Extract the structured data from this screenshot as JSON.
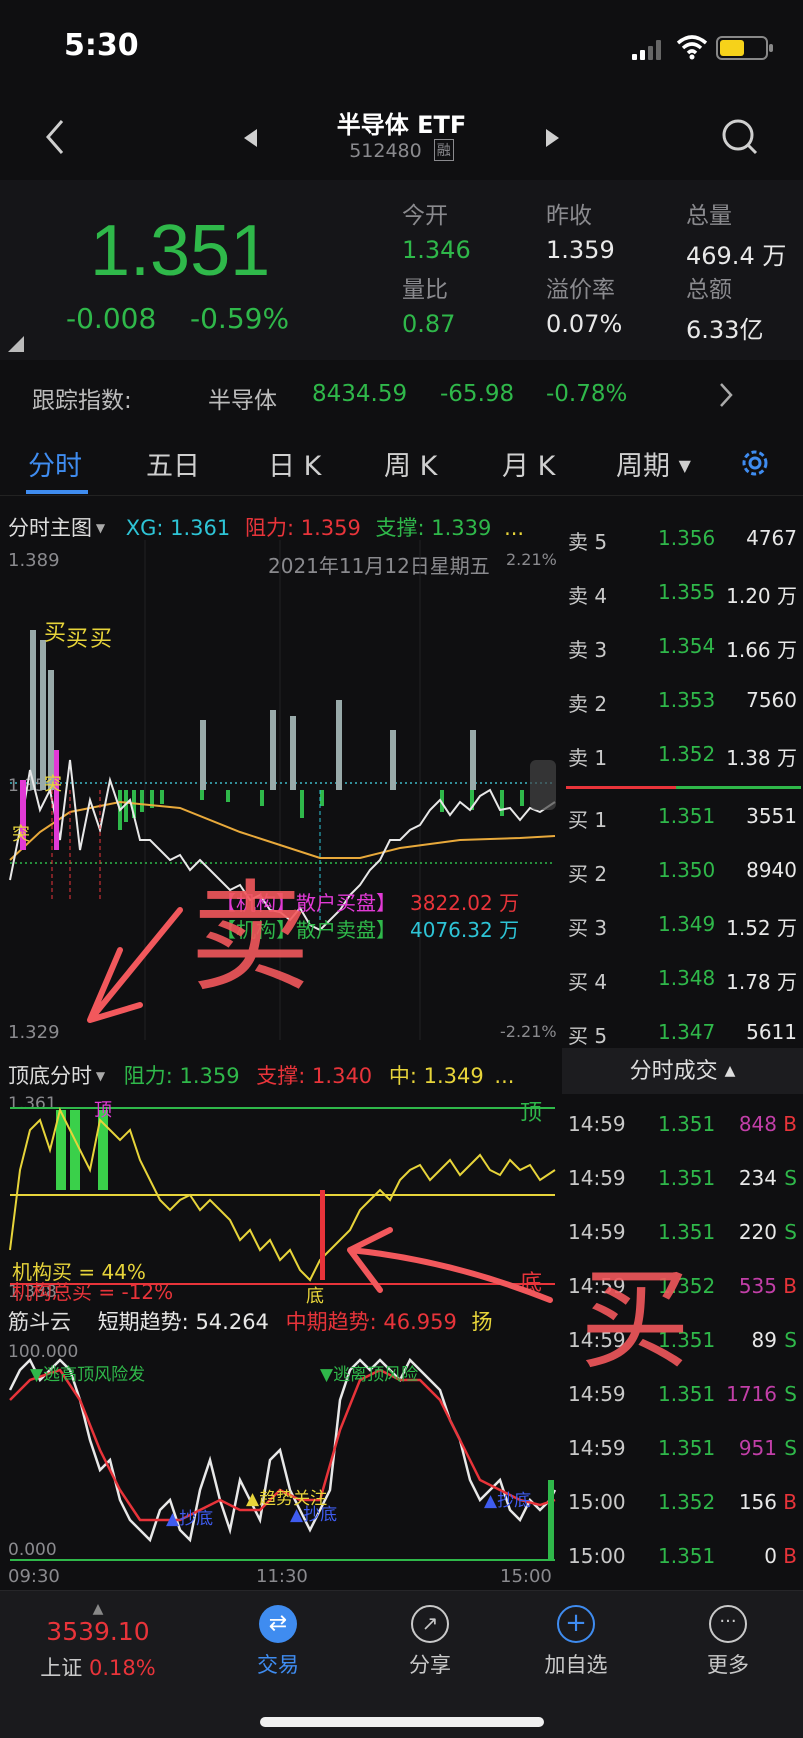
{
  "status": {
    "time": "5:30"
  },
  "nav": {
    "title": "半导体 ETF",
    "code": "512480",
    "badge": "融"
  },
  "quote": {
    "price": "1.351",
    "change": "-0.008",
    "change_pct": "-0.59%",
    "stats": [
      {
        "label": "今开",
        "value": "1.346",
        "color": "green"
      },
      {
        "label": "昨收",
        "value": "1.359",
        "color": "white"
      },
      {
        "label": "总量",
        "value": "469.4 万",
        "color": "white"
      },
      {
        "label": "量比",
        "value": "0.87",
        "color": "green"
      },
      {
        "label": "溢价率",
        "value": "0.07%",
        "color": "white"
      },
      {
        "label": "总额",
        "value": "6.33亿",
        "color": "white"
      }
    ]
  },
  "tracking": {
    "label": "跟踪指数:",
    "name": "半导体",
    "value": "8434.59",
    "change": "-65.98",
    "pct": "-0.78%"
  },
  "tabs": [
    "分时",
    "五日",
    "日 K",
    "周 K",
    "月 K",
    "周期"
  ],
  "main_chart": {
    "title": "分时主图",
    "xg": "XG: 1.361",
    "resistance": "阻力: 1.359",
    "support": "支撑: 1.339",
    "more": "...",
    "high": "1.389",
    "low": "1.329",
    "date": "2021年11月12日星期五",
    "pct_top": "2.21%",
    "pct_bottom": "-2.21%",
    "mid": "1.359",
    "buy_mark": "买",
    "tu_mark": "突",
    "annotation_sell": "卖",
    "legend_line1": "【机构】散户买盘】",
    "legend_val1": "3822.02 万",
    "legend_line2": "【机构】散户卖盘】",
    "legend_val2": "4076.32 万"
  },
  "top_bottom_chart": {
    "title": "顶底分时",
    "resistance": "阻力: 1.359",
    "support": "支撑: 1.340",
    "mid": "中: 1.349",
    "more": "...",
    "top_label": "顶",
    "bottom_label": "底",
    "high": "1.361",
    "low": "1.338",
    "inst_buy": "机构买 = 44%",
    "inst_total": "机构总买 = -12%",
    "annotation_buy": "买"
  },
  "cloud_chart": {
    "title": "筋斗云",
    "short": "短期趋势: 54.264",
    "mid": "中期趋势: 46.959",
    "tail": "扬",
    "y_top": "100.000",
    "y_bottom": "0.000",
    "label_launch": "▼逃离顶风险",
    "label_launch2": "▼逃高顶风险发",
    "label_bottom": "▲抄底",
    "label_bottom2": "▲抄底",
    "label_bottom3": "▲抄底",
    "label_method": "▲趋势关注",
    "x_ticks": [
      "09:30",
      "11:30",
      "15:00"
    ]
  },
  "orderbook": {
    "asks": [
      {
        "label": "卖 5",
        "price": "1.356",
        "vol": "4767"
      },
      {
        "label": "卖 4",
        "price": "1.355",
        "vol": "1.20 万"
      },
      {
        "label": "卖 3",
        "price": "1.354",
        "vol": "1.66 万"
      },
      {
        "label": "卖 2",
        "price": "1.353",
        "vol": "7560"
      },
      {
        "label": "卖 1",
        "price": "1.352",
        "vol": "1.38 万"
      }
    ],
    "bids": [
      {
        "label": "买 1",
        "price": "1.351",
        "vol": "3551"
      },
      {
        "label": "买 2",
        "price": "1.350",
        "vol": "8940"
      },
      {
        "label": "买 3",
        "price": "1.349",
        "vol": "1.52 万"
      },
      {
        "label": "买 4",
        "price": "1.348",
        "vol": "1.78 万"
      },
      {
        "label": "买 5",
        "price": "1.347",
        "vol": "5611"
      }
    ]
  },
  "trades": {
    "title": "分时成交",
    "rows": [
      {
        "time": "14:59",
        "price": "1.351",
        "vol": "848",
        "side": "B",
        "vol_color": "#c23fa8",
        "side_color": "#e8343a"
      },
      {
        "time": "14:59",
        "price": "1.351",
        "vol": "234",
        "side": "S",
        "vol_color": "#e8e8e8",
        "side_color": "#2fb84a"
      },
      {
        "time": "14:59",
        "price": "1.351",
        "vol": "220",
        "side": "S",
        "vol_color": "#e8e8e8",
        "side_color": "#2fb84a"
      },
      {
        "time": "14:59",
        "price": "1.352",
        "vol": "535",
        "side": "B",
        "vol_color": "#c23fa8",
        "side_color": "#e8343a"
      },
      {
        "time": "14:59",
        "price": "1.351",
        "vol": "89",
        "side": "S",
        "vol_color": "#e8e8e8",
        "side_color": "#2fb84a"
      },
      {
        "time": "14:59",
        "price": "1.351",
        "vol": "1716",
        "side": "S",
        "vol_color": "#c23fa8",
        "side_color": "#2fb84a"
      },
      {
        "time": "14:59",
        "price": "1.351",
        "vol": "951",
        "side": "S",
        "vol_color": "#c23fa8",
        "side_color": "#2fb84a"
      },
      {
        "time": "15:00",
        "price": "1.352",
        "vol": "156",
        "side": "B",
        "vol_color": "#e8e8e8",
        "side_color": "#e8343a"
      },
      {
        "time": "15:00",
        "price": "1.351",
        "vol": "0",
        "side": "B",
        "vol_color": "#e8e8e8",
        "side_color": "#e8343a"
      }
    ]
  },
  "bottom_bar": {
    "index_value": "3539.10",
    "index_name": "上证",
    "index_pct": "0.18%",
    "trade": "交易",
    "share": "分享",
    "add": "加自选",
    "more": "更多"
  }
}
